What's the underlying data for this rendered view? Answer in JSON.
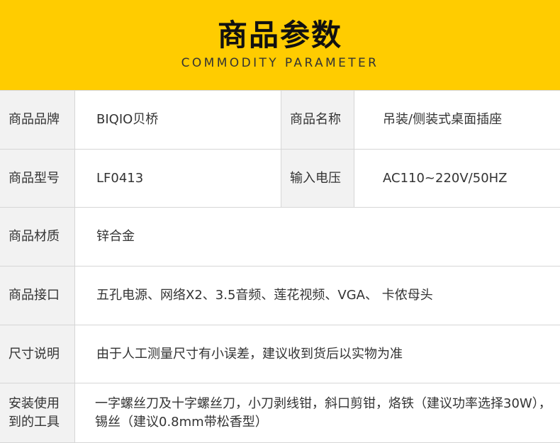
{
  "header": {
    "title": "商品参数",
    "subtitle": "COMMODITY PARAMETER"
  },
  "colors": {
    "header_bg": "#FFCC00",
    "label_bg": "#F2F2F2",
    "border": "#D6D6D6"
  },
  "specs": {
    "brand_label": "商品品牌",
    "brand_value": "BIQIO贝桥",
    "name_label": "商品名称",
    "name_value": "吊装/侧装式桌面插座",
    "model_label": "商品型号",
    "model_value": "LF0413",
    "voltage_label": "输入电压",
    "voltage_value": "AC110~220V/50HZ",
    "material_label": "商品材质",
    "material_value": "锌合金",
    "interface_label": "商品接口",
    "interface_value": "五孔电源、网络X2、3.5音频、莲花视频、VGA、 卡侬母头",
    "size_label": "尺寸说明",
    "size_value": "由于人工测量尺寸有小误差，建议收到货后以实物为准",
    "tools_label": "安装使用到的工具",
    "tools_value": "一字螺丝刀及十字螺丝刀，小刀剥线钳，斜口剪钳，烙铁（建议功率选择30W），锡丝（建议0.8mm带松香型）"
  }
}
